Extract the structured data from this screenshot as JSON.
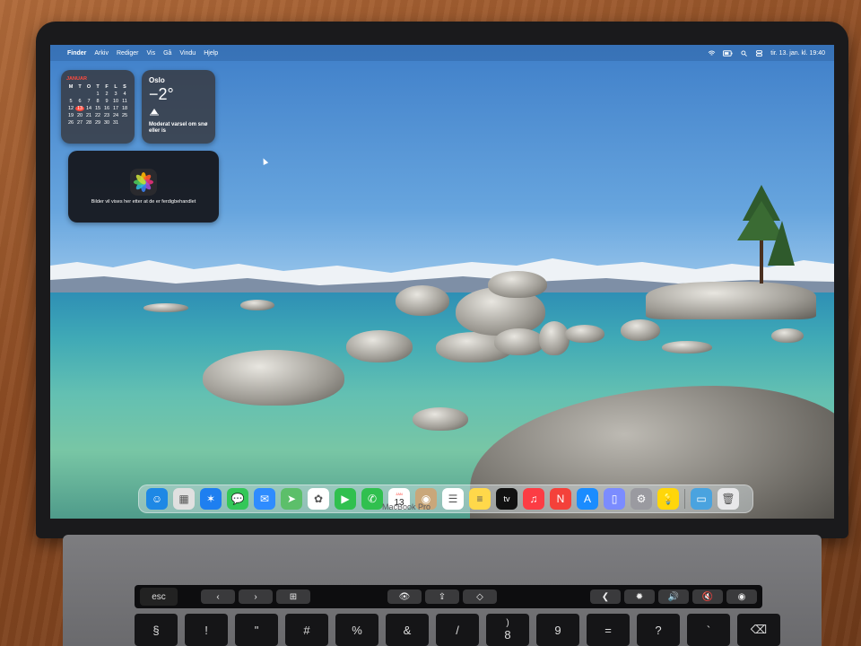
{
  "menubar": {
    "apple_glyph": "",
    "items": [
      "Finder",
      "Arkiv",
      "Rediger",
      "Vis",
      "Gå",
      "Vindu",
      "Hjelp"
    ],
    "clock": "tir. 13. jan. kl. 19:40"
  },
  "calendar_widget": {
    "month": "JANUAR",
    "weekdays": [
      "M",
      "T",
      "O",
      "T",
      "F",
      "L",
      "S"
    ],
    "leading_blanks": 3,
    "days": 31,
    "today": 13,
    "accent": "#ff4a3d"
  },
  "weather_widget": {
    "city": "Oslo",
    "temperature": "−2°",
    "description": "Moderat varsel om snø eller is",
    "icon": "snow-warning-icon"
  },
  "photos_widget": {
    "message": "Bilder vil vises her etter at de er ferdigbehandlet",
    "icon": "photos-app-icon"
  },
  "dock": {
    "apps": [
      {
        "name": "finder",
        "icon": "finder-icon",
        "color": "#1e88e5",
        "glyph": "☺"
      },
      {
        "name": "launchpad",
        "icon": "launchpad-icon",
        "color": "#e0e0e0",
        "glyph": "▦"
      },
      {
        "name": "safari",
        "icon": "safari-icon",
        "color": "#1e7ff0",
        "glyph": "✶"
      },
      {
        "name": "messages",
        "icon": "messages-icon",
        "color": "#34c759",
        "glyph": "💬"
      },
      {
        "name": "mail",
        "icon": "mail-icon",
        "color": "#2f8cff",
        "glyph": "✉"
      },
      {
        "name": "maps",
        "icon": "maps-icon",
        "color": "#5cbf6a",
        "glyph": "➤"
      },
      {
        "name": "photos",
        "icon": "photos-icon",
        "color": "#ffffff",
        "glyph": "✿"
      },
      {
        "name": "facetime",
        "icon": "facetime-icon",
        "color": "#30c04f",
        "glyph": "▶"
      },
      {
        "name": "phone",
        "icon": "phone-icon",
        "color": "#30c04f",
        "glyph": "✆"
      },
      {
        "name": "calendar",
        "icon": "calendar-icon",
        "color": "#ffffff",
        "glyph": "13",
        "month": "JAN"
      },
      {
        "name": "contacts",
        "icon": "contacts-icon",
        "color": "#c9a77a",
        "glyph": "◉"
      },
      {
        "name": "reminders",
        "icon": "reminders-icon",
        "color": "#ffffff",
        "glyph": "☰"
      },
      {
        "name": "notes",
        "icon": "notes-icon",
        "color": "#ffd84a",
        "glyph": "≡"
      },
      {
        "name": "apple-tv",
        "icon": "apple-tv-icon",
        "color": "#111111",
        "glyph": "tv"
      },
      {
        "name": "music",
        "icon": "music-icon",
        "color": "#fc3c44",
        "glyph": "♫"
      },
      {
        "name": "news",
        "icon": "news-icon",
        "color": "#f4413a",
        "glyph": "N"
      },
      {
        "name": "app-store",
        "icon": "app-store-icon",
        "color": "#1a8cff",
        "glyph": "A"
      },
      {
        "name": "iphone-mirroring",
        "icon": "iphone-mirroring-icon",
        "color": "#7b8cff",
        "glyph": "▯"
      },
      {
        "name": "system-settings",
        "icon": "system-settings-icon",
        "color": "#9a9aa0",
        "glyph": "⚙"
      },
      {
        "name": "tips",
        "icon": "tips-icon",
        "color": "#ffd60a",
        "glyph": "💡"
      }
    ],
    "trailing": [
      {
        "name": "downloads-folder",
        "icon": "folder-icon",
        "color": "#4aa3df",
        "glyph": "▭"
      },
      {
        "name": "trash",
        "icon": "trash-icon",
        "color": "#e8e8ea",
        "glyph": "🗑"
      }
    ]
  },
  "laptop": {
    "model_label": "MacBook Pro",
    "esc_label": "esc",
    "touchbar_left": [
      "‹",
      "›",
      "⊞"
    ],
    "touchbar_mid": [
      "👁",
      "⇪",
      "◇"
    ],
    "touchbar_right": [
      "❮",
      "✹",
      "🔊",
      "🔇",
      "◉"
    ],
    "number_keys": [
      {
        "top": "",
        "bottom": "§"
      },
      {
        "top": "",
        "bottom": "!"
      },
      {
        "top": "",
        "bottom": "\""
      },
      {
        "top": "",
        "bottom": "#"
      },
      {
        "top": "",
        "bottom": "%"
      },
      {
        "top": "",
        "bottom": "&"
      },
      {
        "top": "",
        "bottom": "/"
      },
      {
        "top": ")",
        "bottom": "8"
      },
      {
        "top": "",
        "bottom": "9"
      },
      {
        "top": "",
        "bottom": "="
      },
      {
        "top": "",
        "bottom": "?"
      },
      {
        "top": "",
        "bottom": "`"
      },
      {
        "top": "",
        "bottom": "⌫"
      }
    ]
  }
}
